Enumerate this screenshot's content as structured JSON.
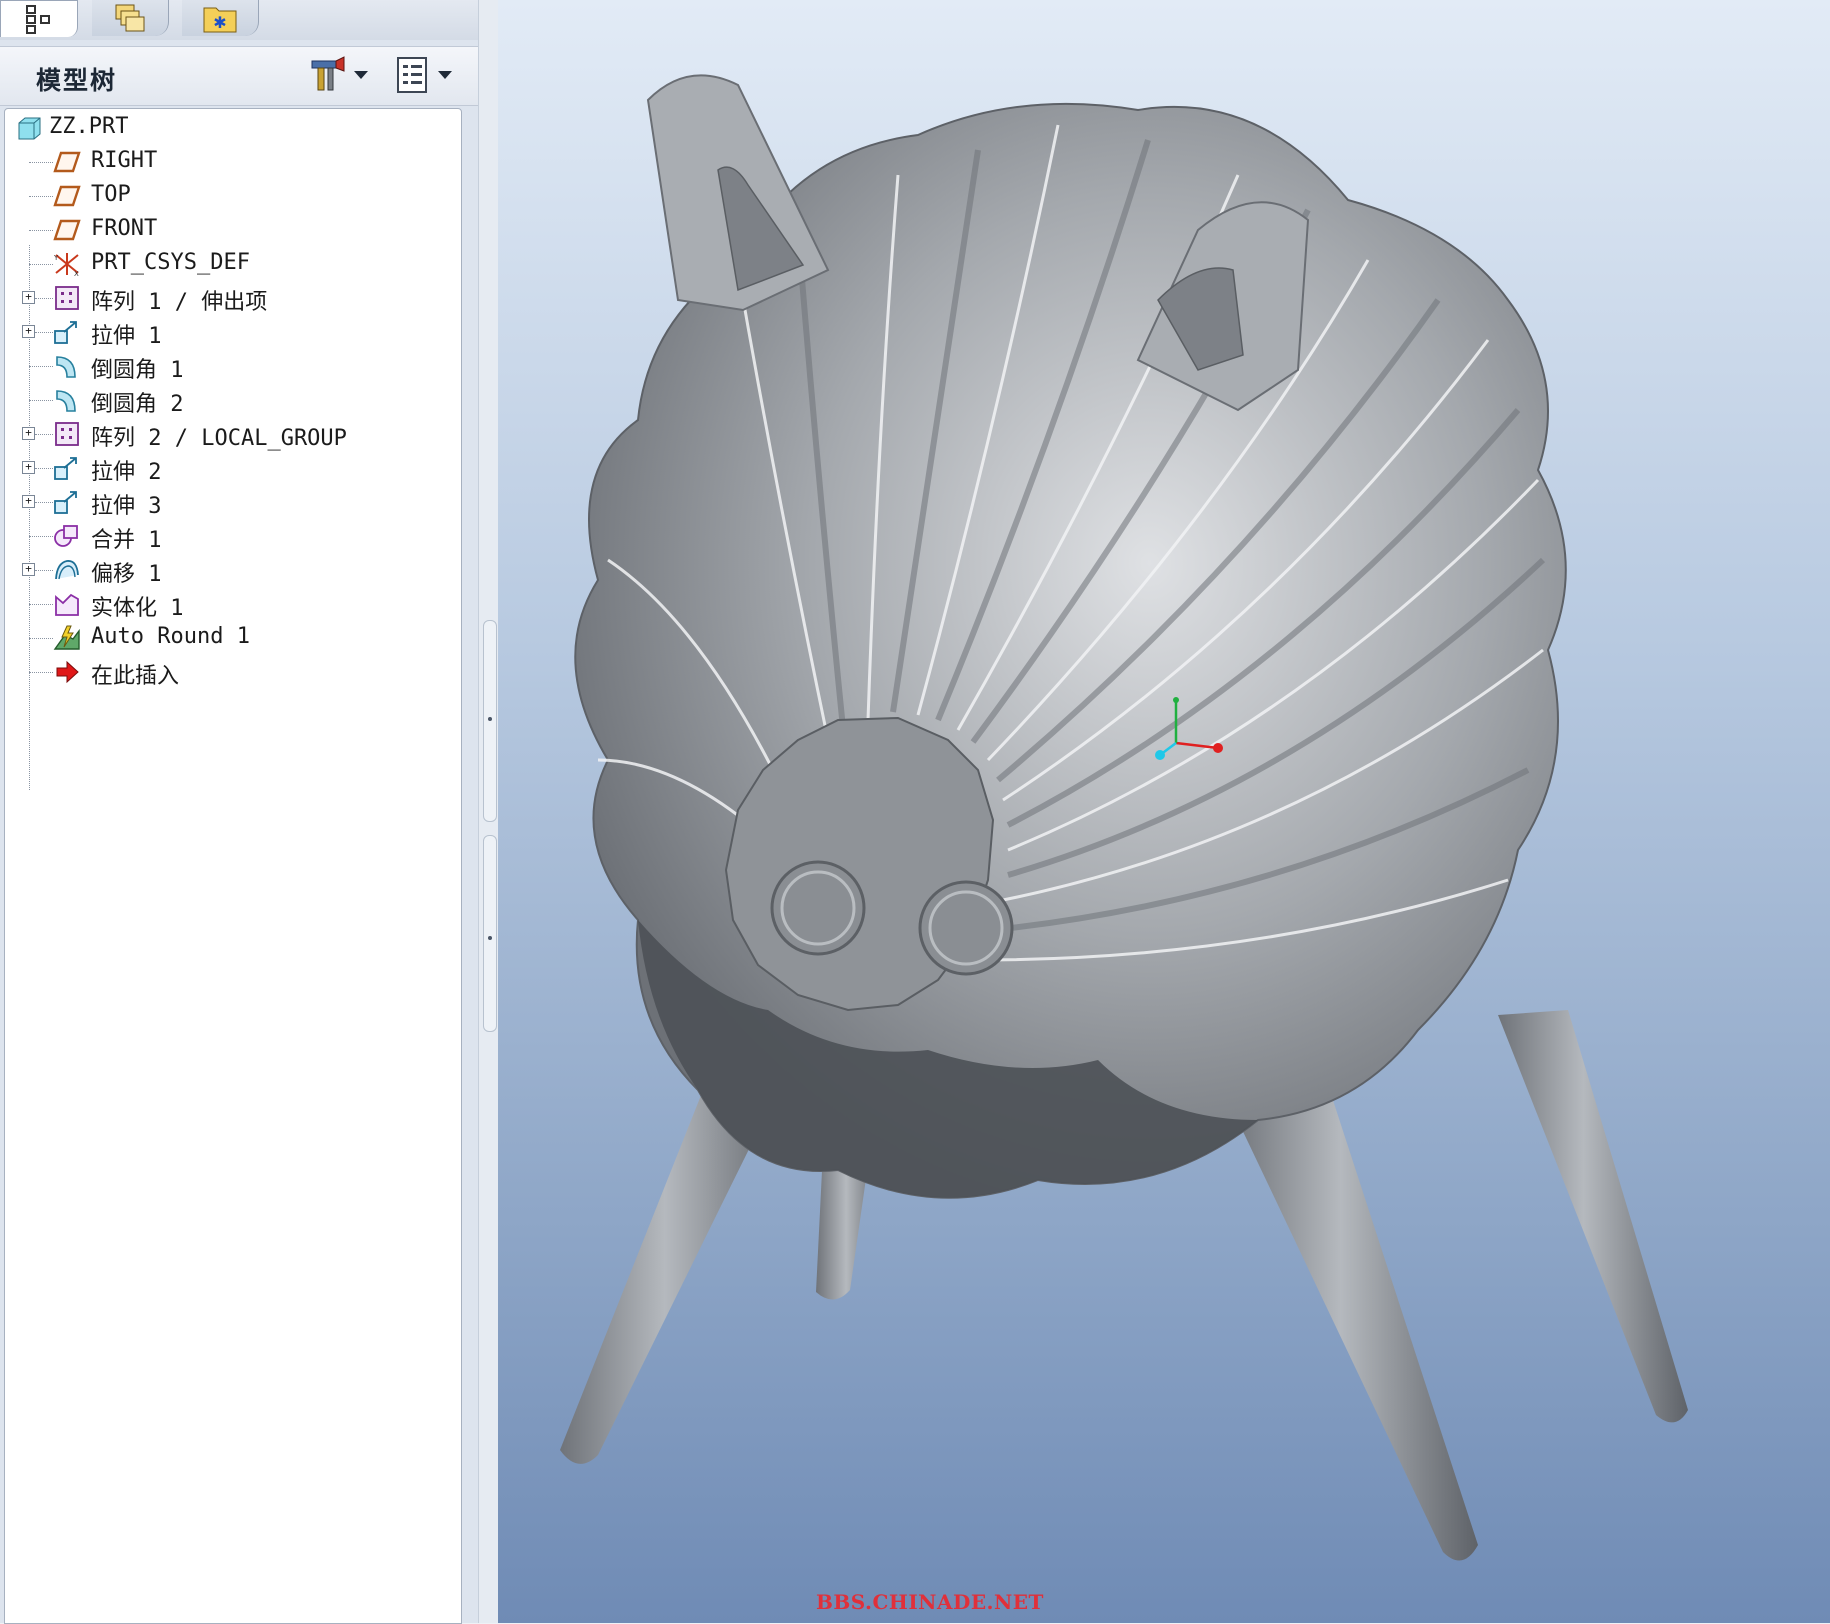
{
  "left_panel": {
    "tabs": [
      {
        "icon": "model-tree-tab-icon",
        "active": true
      },
      {
        "icon": "folder-browser-tab-icon",
        "active": false
      },
      {
        "icon": "favorites-tab-icon",
        "active": false
      }
    ],
    "tree_header": {
      "title": "模型树",
      "settings_icon": "tools-settings-icon",
      "show_icon": "show-list-icon"
    },
    "tree": {
      "root": {
        "label": "ZZ.PRT",
        "icon": "part-icon"
      },
      "items": [
        {
          "label": "RIGHT",
          "icon": "datum-plane-icon",
          "expandable": false
        },
        {
          "label": "TOP",
          "icon": "datum-plane-icon",
          "expandable": false
        },
        {
          "label": "FRONT",
          "icon": "datum-plane-icon",
          "expandable": false
        },
        {
          "label": "PRT_CSYS_DEF",
          "icon": "coordinate-system-icon",
          "expandable": false
        },
        {
          "label": "阵列 1 / 伸出项",
          "icon": "pattern-icon",
          "expandable": true
        },
        {
          "label": "拉伸 1",
          "icon": "extrude-icon",
          "expandable": true
        },
        {
          "label": "倒圆角 1",
          "icon": "round-icon",
          "expandable": false
        },
        {
          "label": "倒圆角 2",
          "icon": "round-icon",
          "expandable": false
        },
        {
          "label": "阵列 2 / LOCAL_GROUP",
          "icon": "pattern-icon",
          "expandable": true
        },
        {
          "label": "拉伸 2",
          "icon": "extrude-icon",
          "expandable": true
        },
        {
          "label": "拉伸 3",
          "icon": "extrude-icon",
          "expandable": true
        },
        {
          "label": "合并 1",
          "icon": "merge-icon",
          "expandable": false
        },
        {
          "label": "偏移 1",
          "icon": "offset-icon",
          "expandable": true
        },
        {
          "label": "实体化 1",
          "icon": "solidify-icon",
          "expandable": false
        },
        {
          "label": "Auto Round 1",
          "icon": "auto-round-icon",
          "expandable": false
        },
        {
          "label": "在此插入",
          "icon": "insert-here-arrow-icon",
          "expandable": false
        }
      ]
    }
  },
  "viewport": {
    "watermark": "BBS.CHINADE.NET",
    "csys_triad_colors": {
      "x": "#e02020",
      "y": "#20b040",
      "z": "#20c8e8"
    }
  },
  "colors": {
    "model_gray": "#9a9ea4",
    "background_top": "#e2ebf6",
    "background_bottom": "#6f8bb5",
    "watermark": "#e0303a"
  }
}
